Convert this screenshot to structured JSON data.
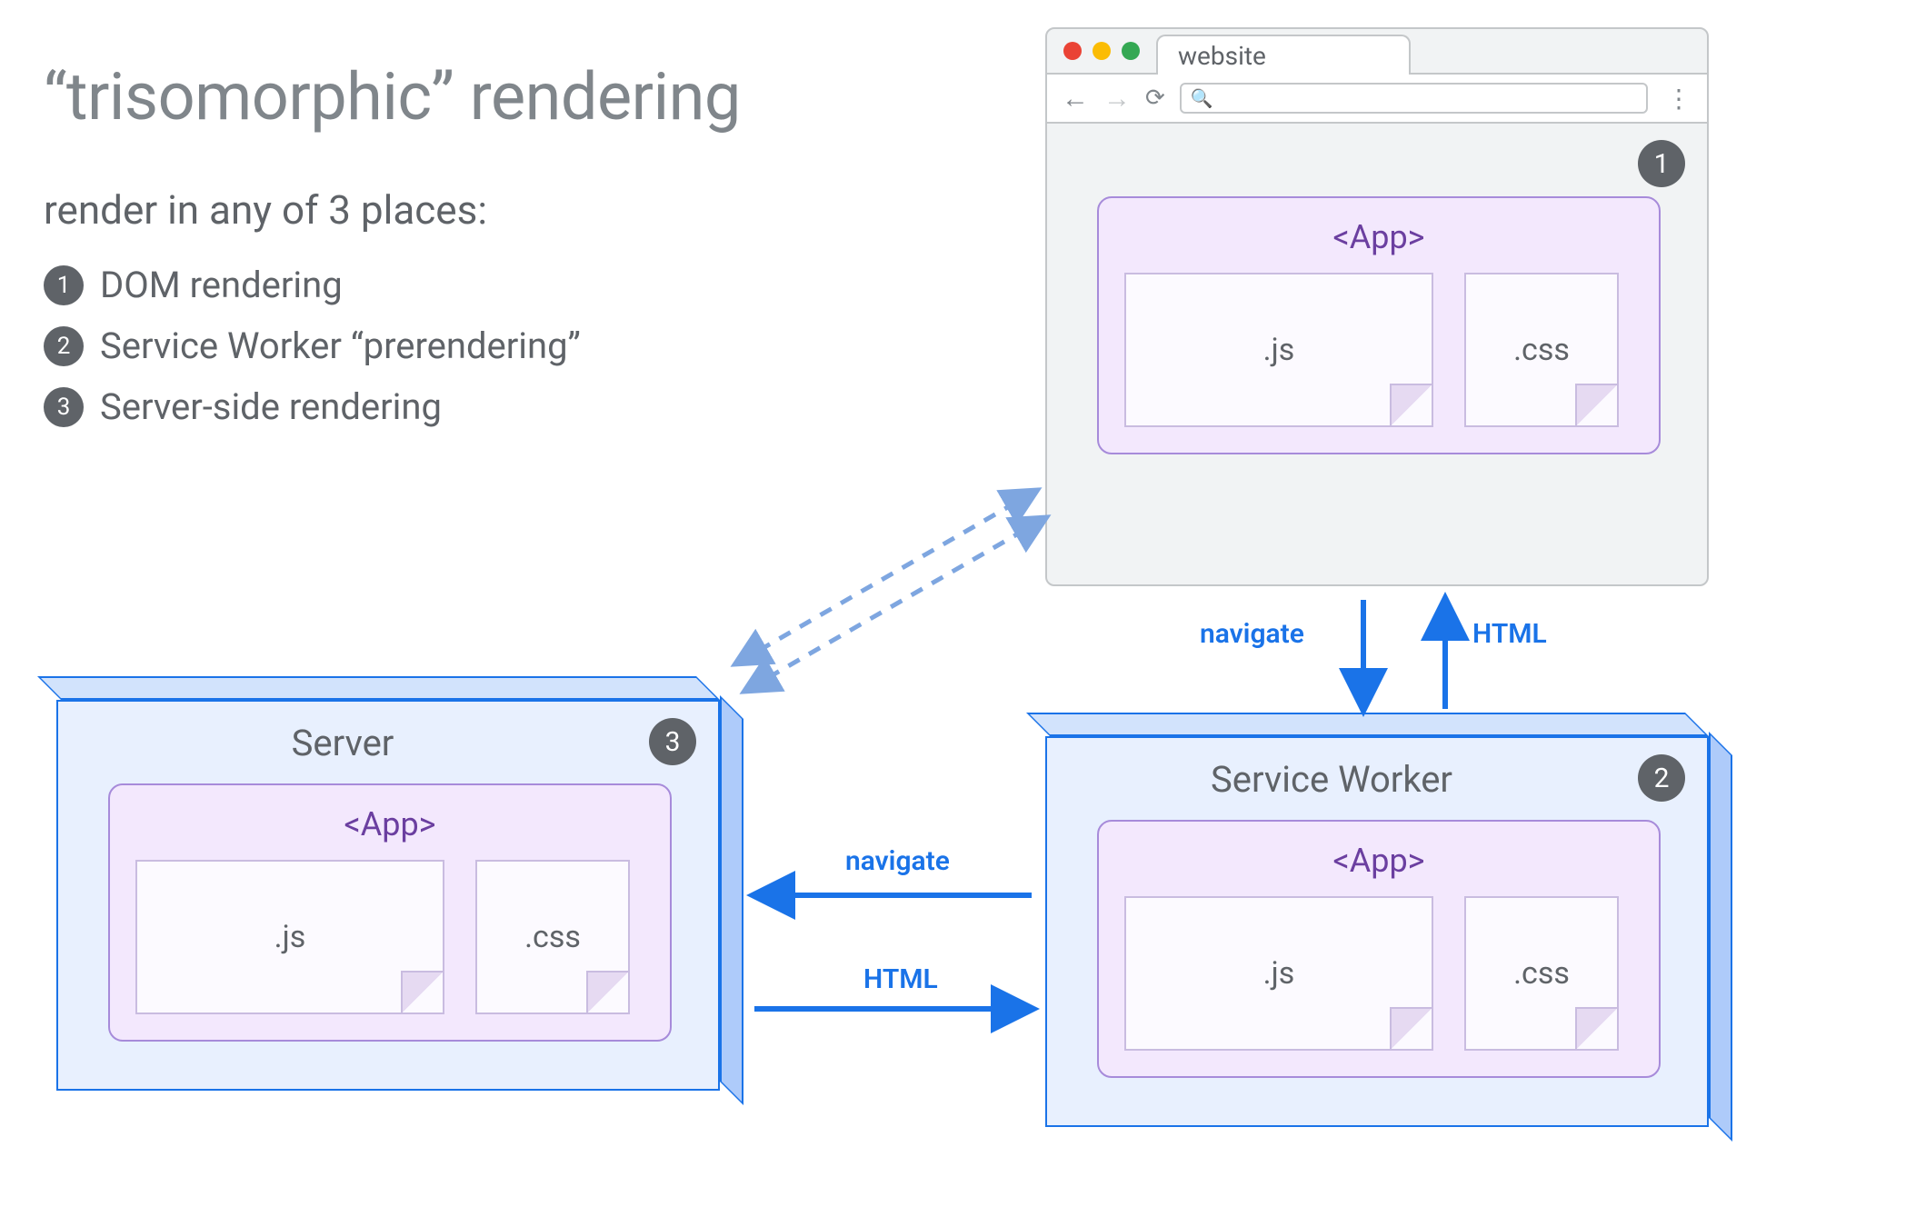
{
  "title": "“trisomorphic” rendering",
  "subtitle": "render in any of 3 places:",
  "items": [
    {
      "num": "1",
      "label": "DOM rendering"
    },
    {
      "num": "2",
      "label": "Service Worker “prerendering”"
    },
    {
      "num": "3",
      "label": "Server-side rendering"
    }
  ],
  "browser": {
    "tab_label": "website",
    "badge": "1",
    "app_label": "<App>",
    "file_js": ".js",
    "file_css": ".css"
  },
  "service_worker": {
    "title": "Service Worker",
    "badge": "2",
    "app_label": "<App>",
    "file_js": ".js",
    "file_css": ".css"
  },
  "server": {
    "title": "Server",
    "badge": "3",
    "app_label": "<App>",
    "file_js": ".js",
    "file_css": ".css"
  },
  "arrows": {
    "browser_to_sw": "navigate",
    "sw_to_browser": "HTML",
    "sw_to_server": "navigate",
    "server_to_sw": "HTML"
  },
  "colors": {
    "blue": "#1a73e8",
    "panel_light": "#e8f0fe",
    "panel_mid": "#d2e3fc",
    "panel_dark": "#aecbfa",
    "purple_fill": "#f3e8fd",
    "purple_border": "#a78bda",
    "purple_text": "#6b3fa0",
    "grey_text": "#5f6368",
    "badge": "#5f6368"
  }
}
